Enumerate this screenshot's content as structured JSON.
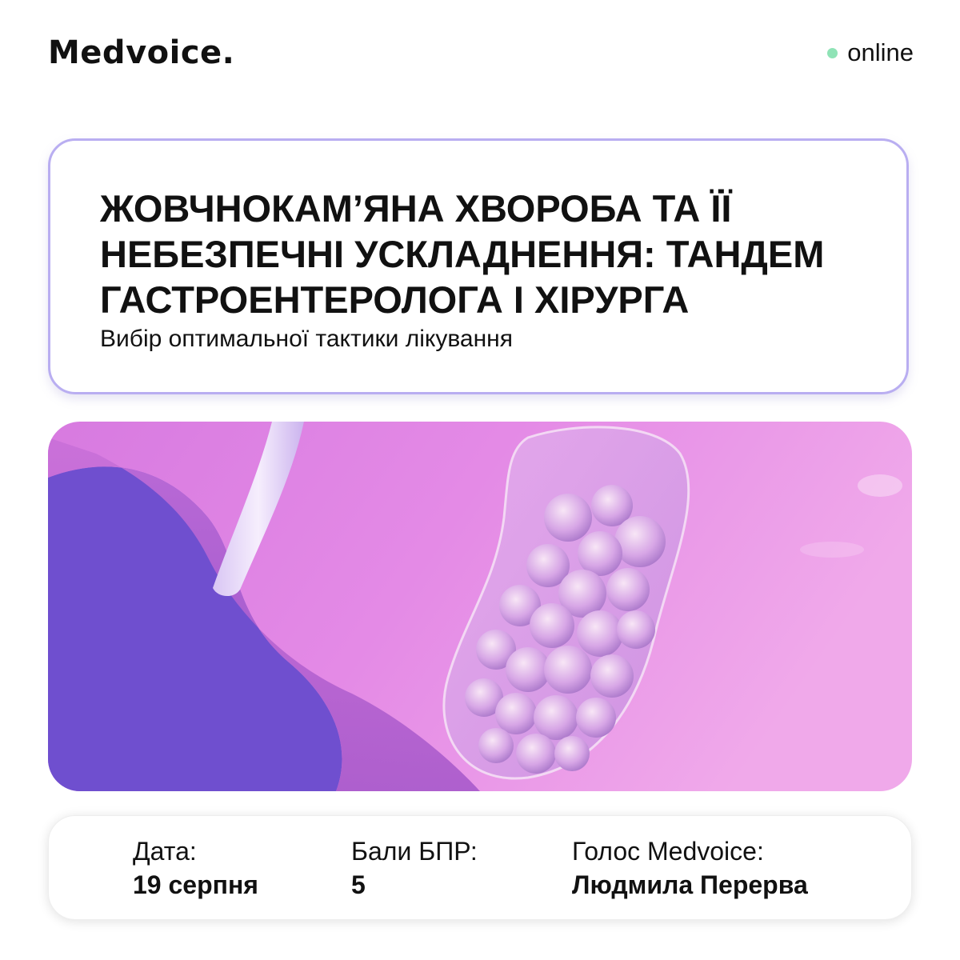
{
  "brand": {
    "logo_text": "Medvoice."
  },
  "status": {
    "text": "online",
    "dot_color": "#8fe3b6"
  },
  "event": {
    "title": "ЖОВЧНОКАМ’ЯНА ХВОРОБА ТА ЇЇ НЕБЕЗПЕЧНІ УСКЛАДНЕННЯ: ТАНДЕМ ГАСТРОЕНТЕРОЛОГА І ХІРУРГА",
    "subtitle": "Вибір оптимальної тактики лікування"
  },
  "hero_image": {
    "icon": "gallbladder-stones-illustration",
    "accent": "#6f4fcf",
    "tint": "#e07ee0"
  },
  "info": {
    "date_label": "Дата:",
    "date_value": "19 серпня",
    "points_label": "Бали БПР:",
    "points_value": "5",
    "voice_label": "Голос Medvoice:",
    "voice_value": "Людмила Перерва"
  },
  "colors": {
    "card_border": "#b9aef1",
    "text": "#111111"
  }
}
